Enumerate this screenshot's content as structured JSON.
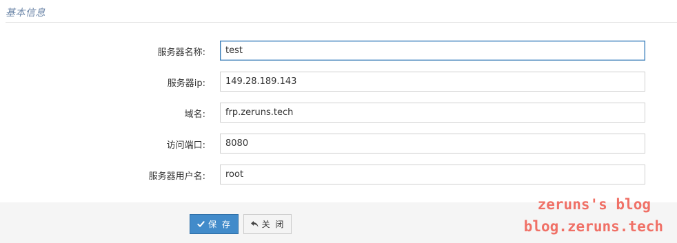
{
  "section": {
    "title": "基本信息"
  },
  "form": {
    "fields": [
      {
        "label": "服务器名称:",
        "value": "test"
      },
      {
        "label": "服务器ip:",
        "value": "149.28.189.143"
      },
      {
        "label": "域名:",
        "value": "frp.zeruns.tech"
      },
      {
        "label": "访问端口:",
        "value": "8080"
      },
      {
        "label": "服务器用户名:",
        "value": "root"
      }
    ]
  },
  "actions": {
    "save_label": "保 存",
    "save_icon": "check-icon",
    "close_label": "关 闭",
    "close_icon": "reply-arrow-icon"
  },
  "watermark": {
    "line1": "zeruns's blog",
    "line2": "blog.zeruns.tech",
    "color": "#f07066"
  },
  "colors": {
    "primary": "#428bca",
    "title": "#6c86a8",
    "focus_border": "#3a7cb6"
  }
}
